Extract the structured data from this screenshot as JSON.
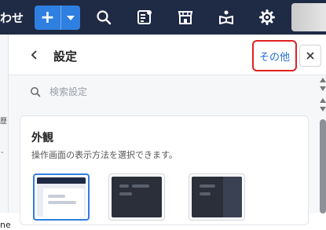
{
  "topbar": {
    "left_text": "わせ",
    "add_label": "+",
    "icons": [
      "search-icon",
      "assignment-icon",
      "store-icon",
      "book-icon",
      "gear-icon"
    ]
  },
  "underlay": {
    "bit1": "歴",
    "bit2": "ne",
    "bit3": "-"
  },
  "panel": {
    "title": "設定",
    "more_label": "その他",
    "close_label": "✕",
    "search_placeholder": "検索設定"
  },
  "appearance": {
    "title": "外観",
    "description": "操作画面の表示方法を選択できます。",
    "themes": [
      "light",
      "dark",
      "mixed"
    ],
    "selected_theme": "light"
  },
  "colors": {
    "topbar": "#1f2a44",
    "accent": "#2f7fe0",
    "highlight": "#e02020"
  }
}
